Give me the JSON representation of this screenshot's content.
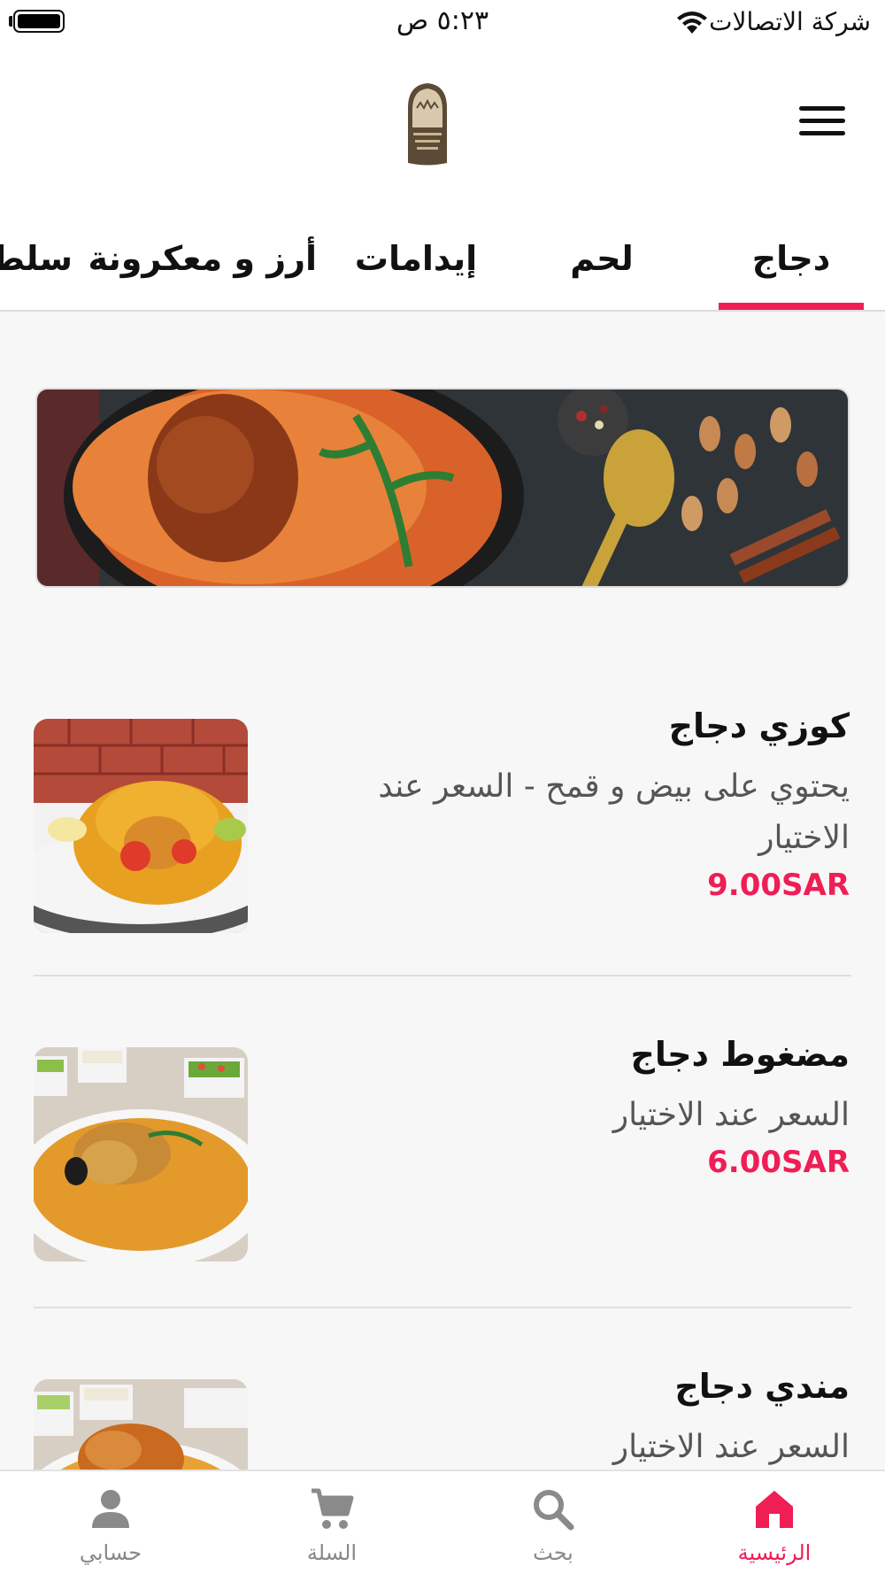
{
  "status_bar": {
    "carrier": "شركة الاتصالات",
    "time": "٥:٢٣ ص"
  },
  "header": {
    "logo_icon": "restaurant-logo-icon",
    "menu_icon": "hamburger-menu-icon"
  },
  "tabs": {
    "items": [
      {
        "label": "دجاج",
        "active": true
      },
      {
        "label": "لحم"
      },
      {
        "label": "إيدامات"
      },
      {
        "label": "أرز و معكرونة"
      },
      {
        "label": "سلطات"
      }
    ]
  },
  "products": [
    {
      "name": "كوزي دجاج",
      "description": "يحتوي على بيض و قمح - السعر عند الاختيار",
      "price": "9.00SAR"
    },
    {
      "name": "مضغوط دجاج",
      "description": "السعر عند الاختيار",
      "price": "6.00SAR"
    },
    {
      "name": "مندي دجاج",
      "description": "السعر عند الاختيار",
      "price": ""
    }
  ],
  "bottom_nav": {
    "items": [
      {
        "label": "الرئيسية",
        "icon": "home-icon",
        "active": true
      },
      {
        "label": "بحث",
        "icon": "search-icon"
      },
      {
        "label": "السلة",
        "icon": "cart-icon"
      },
      {
        "label": "حسابي",
        "icon": "account-icon"
      }
    ]
  },
  "colors": {
    "accent": "#ef1e55",
    "background": "#f7f7f7"
  }
}
